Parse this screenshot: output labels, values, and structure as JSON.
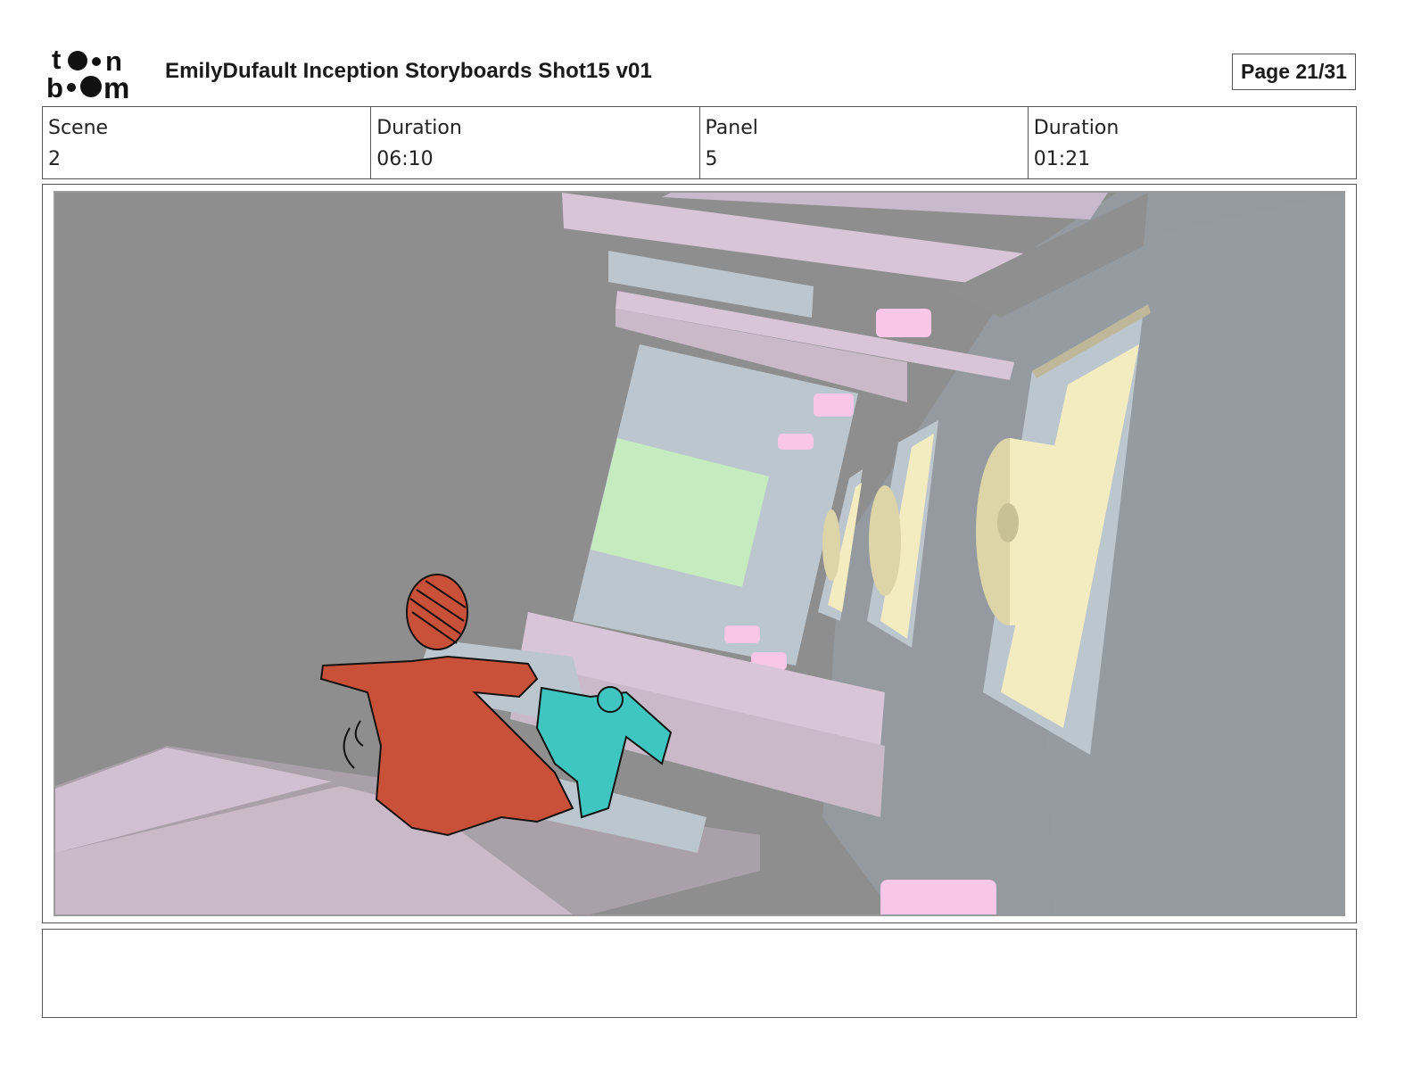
{
  "header": {
    "logo": {
      "line1": "toon",
      "line2": "boom"
    },
    "title": "EmilyDufault Inception Storyboards Shot15 v01",
    "page": "Page 21/31"
  },
  "info": {
    "scene_label": "Scene",
    "scene_value": "2",
    "scene_duration_label": "Duration",
    "scene_duration_value": "06:10",
    "panel_label": "Panel",
    "panel_value": "5",
    "panel_duration_label": "Duration",
    "panel_duration_value": "01:21"
  },
  "panel": {
    "image": "storyboard-panel-illustration",
    "colors": {
      "background": "#8e8e8e",
      "beams": "#d8c6d8",
      "beam_shadow": "#b9a9b9",
      "wall": "#bcc6cf",
      "screen": "#c6ebbf",
      "lights": "#f8c6e6",
      "drums": "#f3ecc0",
      "character_red": "#c9513a",
      "character_teal": "#3fc6c0"
    }
  },
  "notes": {
    "text": ""
  }
}
